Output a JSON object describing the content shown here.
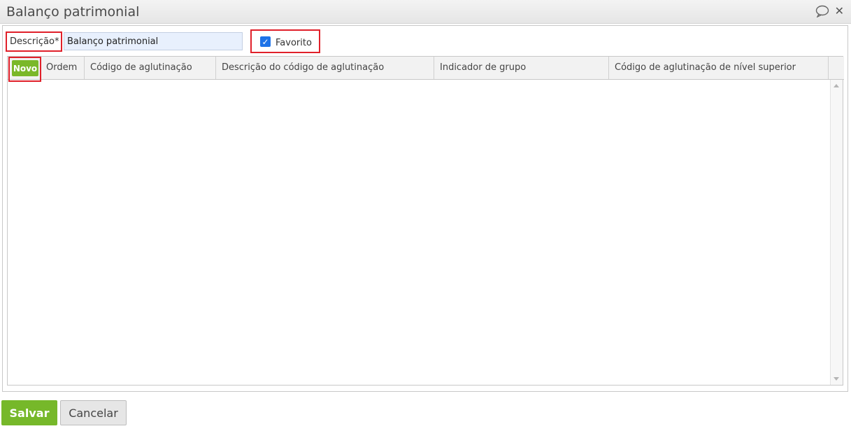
{
  "window": {
    "title": "Balanço patrimonial",
    "icons": [
      "chat-bubble-icon",
      "close-icon"
    ],
    "close_glyph": "✕"
  },
  "form": {
    "description_label": "Descrição*",
    "description_value": "Balanço patrimonial",
    "favorite_label": "Favorito",
    "favorite_checked": true
  },
  "grid": {
    "new_button_label": "Novo",
    "columns": [
      "Ordem",
      "Código de aglutinação",
      "Descrição do código de aglutinação",
      "Indicador de grupo",
      "Código de aglutinação de nível superior"
    ],
    "rows": []
  },
  "footer": {
    "save_label": "Salvar",
    "cancel_label": "Cancelar"
  },
  "colors": {
    "accent_green": "#76b82a",
    "highlight_red": "#e0202a",
    "checkbox_blue": "#1e73e8",
    "input_bg": "#e8f0fd"
  }
}
